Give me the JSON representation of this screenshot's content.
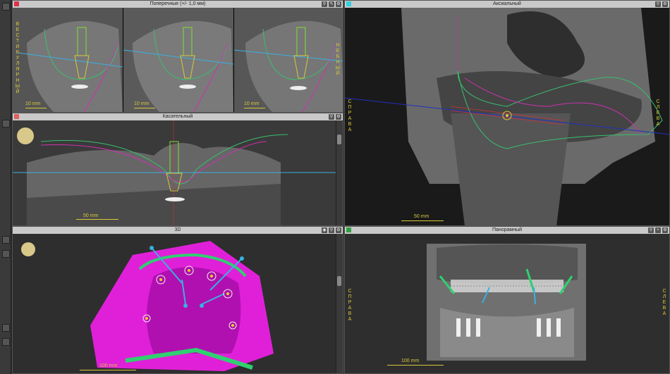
{
  "panels": {
    "cross": {
      "title": "Поперечные (+/- 1,0 мм)",
      "scale": "10 mm",
      "left_side": "ВЕСТИБУЛЯРНЫЙ",
      "right_side": "НЕБНЫЙ"
    },
    "tangent": {
      "title": "Касательный",
      "scale": "50 mm"
    },
    "axial": {
      "title": "Аксиальный",
      "scale": "50 mm",
      "left_side": "СПРАВА",
      "right_side": "СЛЕВА"
    },
    "view3d": {
      "title": "3D",
      "scale": "100 mm"
    },
    "panoramic": {
      "title": "Панорамный",
      "scale": "100 mm",
      "left_side": "СПРАВА",
      "right_side": "СЛЕВА"
    }
  },
  "colors": {
    "cross_swatch": "#e0304a",
    "axial_swatch": "#30d0e0",
    "pano_swatch": "#30a040",
    "tangent_swatch": "#e06060",
    "annotation": "#d8c83a",
    "gum_line": "#38c070",
    "bone_line": "#d030b0",
    "ref_line": "#3ab0e0"
  },
  "icons": [
    "pin-icon",
    "pencil-icon",
    "eye-icon",
    "plus-icon",
    "gear-icon"
  ]
}
